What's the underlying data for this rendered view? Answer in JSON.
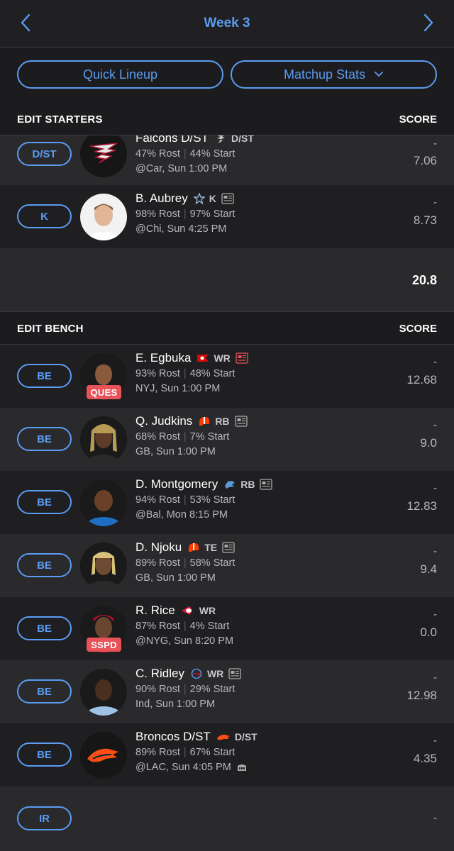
{
  "header": {
    "title": "Week 3"
  },
  "actions": {
    "quick_lineup": "Quick Lineup",
    "matchup_stats": "Matchup Stats"
  },
  "starters": {
    "label": "EDIT STARTERS",
    "score_label": "SCORE",
    "total": "20.8",
    "players": [
      {
        "slot": "D/ST",
        "name": "Falcons D/ST",
        "pos": "D/ST",
        "rost": "47% Rost",
        "start": "44% Start",
        "game": "@Car, Sun 1:00 PM",
        "dash": "-",
        "proj": "7.06",
        "team": "falcons-logo-icon"
      },
      {
        "slot": "K",
        "name": "B. Aubrey",
        "pos": "K",
        "rost": "98% Rost",
        "start": "97% Start",
        "game": "@Chi, Sun 4:25 PM",
        "dash": "-",
        "proj": "8.73",
        "team": "cowboys-star-icon"
      }
    ]
  },
  "bench": {
    "label": "EDIT BENCH",
    "score_label": "SCORE",
    "players": [
      {
        "slot": "BE",
        "name": "E. Egbuka",
        "pos": "WR",
        "rost": "93% Rost",
        "start": "48% Start",
        "game": "NYJ, Sun 1:00 PM",
        "dash": "-",
        "proj": "12.68",
        "status": "QUES",
        "team": "buccaneers-flag-icon"
      },
      {
        "slot": "BE",
        "name": "Q. Judkins",
        "pos": "RB",
        "rost": "68% Rost",
        "start": "7% Start",
        "game": "GB, Sun 1:00 PM",
        "dash": "-",
        "proj": "9.0",
        "team": "browns-helmet-icon"
      },
      {
        "slot": "BE",
        "name": "D. Montgomery",
        "pos": "RB",
        "rost": "94% Rost",
        "start": "53% Start",
        "game": "@Bal, Mon 8:15 PM",
        "dash": "-",
        "proj": "12.83",
        "team": "lions-logo-icon"
      },
      {
        "slot": "BE",
        "name": "D. Njoku",
        "pos": "TE",
        "rost": "89% Rost",
        "start": "58% Start",
        "game": "GB, Sun 1:00 PM",
        "dash": "-",
        "proj": "9.4",
        "team": "browns-helmet-icon"
      },
      {
        "slot": "BE",
        "name": "R. Rice",
        "pos": "WR",
        "rost": "87% Rost",
        "start": "4% Start",
        "game": "@NYG, Sun 8:20 PM",
        "dash": "-",
        "proj": "0.0",
        "status": "SSPD",
        "team": "chiefs-arrowhead-icon"
      },
      {
        "slot": "BE",
        "name": "C. Ridley",
        "pos": "WR",
        "rost": "90% Rost",
        "start": "29% Start",
        "game": "Ind, Sun 1:00 PM",
        "dash": "-",
        "proj": "12.98",
        "team": "titans-logo-icon"
      },
      {
        "slot": "BE",
        "name": "Broncos D/ST",
        "pos": "D/ST",
        "rost": "89% Rost",
        "start": "67% Start",
        "game": "@LAC, Sun 4:05 PM",
        "dash": "-",
        "proj": "4.35",
        "team": "broncos-logo-icon"
      }
    ],
    "ir_slot": {
      "slot": "IR",
      "dash": "-"
    }
  },
  "colors": {
    "accent": "#5b9cf3",
    "status_red": "#e8535a"
  }
}
